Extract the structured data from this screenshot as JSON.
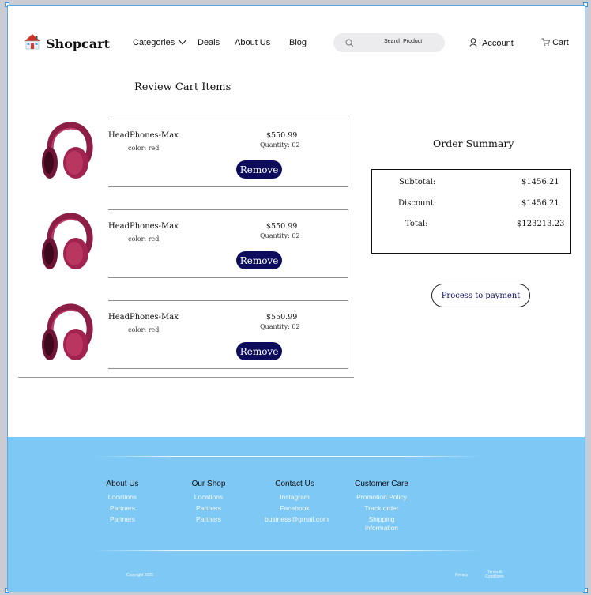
{
  "header": {
    "brand": "Shopcart",
    "nav": [
      "Categories",
      "Deals",
      "About Us",
      "Blog"
    ],
    "search_placeholder": "Search Product",
    "account_label": "Account",
    "cart_label": "Cart"
  },
  "cart": {
    "title": "Review Cart Items",
    "items": [
      {
        "name": "HeadPhones-Max",
        "color": "color: red",
        "price": "$550.99",
        "quantity": "Quantity: 02",
        "remove_label": "Remove"
      },
      {
        "name": "HeadPhones-Max",
        "color": "color: red",
        "price": "$550.99",
        "quantity": "Quantity: 02",
        "remove_label": "Remove"
      },
      {
        "name": "HeadPhones-Max",
        "color": "color: red",
        "price": "$550.99",
        "quantity": "Quantity: 02",
        "remove_label": "Remove"
      }
    ]
  },
  "summary": {
    "title": "Order Summary",
    "subtotal_label": "Subtotal:",
    "subtotal_value": "$1456.21",
    "discount_label": "Discount:",
    "discount_value": "$1456.21",
    "total_label": "Total:",
    "total_value": "$123213.23",
    "payment_button": "Process to payment"
  },
  "footer": {
    "columns": [
      {
        "heading": "About Us",
        "links": [
          "Locations",
          "Partners",
          "Partners"
        ]
      },
      {
        "heading": "Our Shop",
        "links": [
          "Locations",
          "Partners",
          "Partners"
        ]
      },
      {
        "heading": "Contact Us",
        "links": [
          "Instagram",
          "Facebook",
          "business@gmail.com"
        ]
      },
      {
        "heading": "Customer Care",
        "links": [
          "Promotion Policy",
          "Track order",
          "Shipping information"
        ]
      }
    ],
    "copyright": "Copyright 2025",
    "privacy": "Privacy",
    "terms": "Terms & Conditions"
  },
  "colors": {
    "accent": "#0d0c5c",
    "footer_bg": "#7ec8f5",
    "product": "#a1234f"
  }
}
